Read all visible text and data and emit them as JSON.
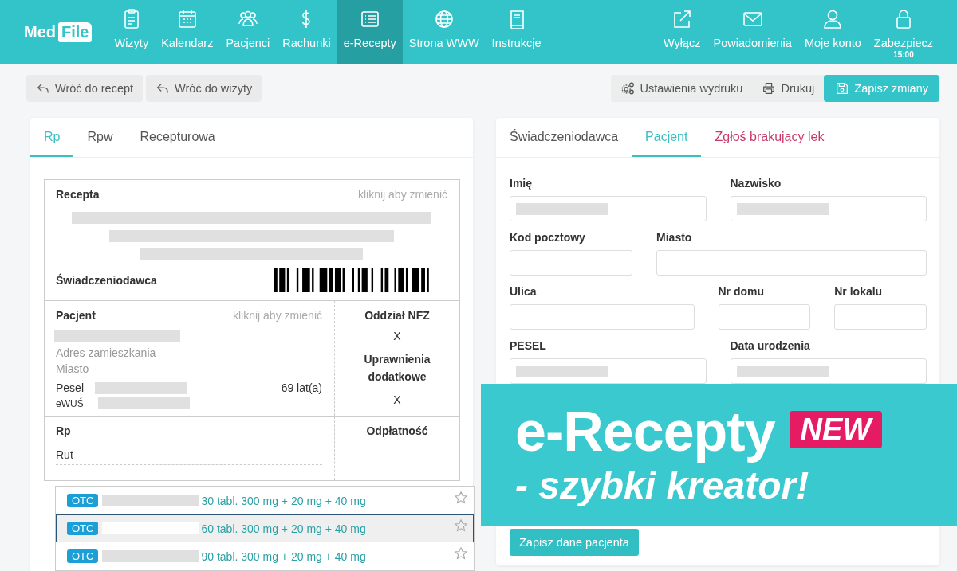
{
  "header": {
    "logo": {
      "part_1": "Med",
      "part_2": "File"
    },
    "nav": [
      {
        "label": "Wizyty",
        "selected": false
      },
      {
        "label": "Kalendarz",
        "selected": false
      },
      {
        "label": "Pacjenci",
        "selected": false
      },
      {
        "label": "Rachunki",
        "selected": false
      },
      {
        "label": "e-Recepty",
        "selected": true
      },
      {
        "label": "Strona WWW",
        "selected": false
      },
      {
        "label": "Instrukcje",
        "selected": false
      }
    ],
    "right_nav": [
      {
        "label": "Wyłącz"
      },
      {
        "label": "Powiadomienia"
      },
      {
        "label": "Moje konto"
      },
      {
        "label": "Zabezpiecz",
        "time": "15:00"
      }
    ]
  },
  "toolbar": {
    "left_buttons": [
      "Wróć do recept",
      "Wróć do wizyty"
    ],
    "right_buttons": [
      {
        "label": "Ustawienia wydruku",
        "kind": "plain"
      },
      {
        "label": "Drukuj",
        "kind": "plain"
      },
      {
        "label": "Zapisz zmiany",
        "kind": "primary"
      }
    ]
  },
  "left_panel": {
    "tabs": [
      {
        "label": "Rp",
        "selected": true
      },
      {
        "label": "Rpw",
        "selected": false
      },
      {
        "label": "Recepturowa",
        "selected": false
      }
    ],
    "recepta": {
      "title": "Recepta",
      "hint": "kliknij aby zmienić",
      "provider_label": "Świadczeniodawca"
    },
    "patient": {
      "title": "Pacjent",
      "hint": "kliknij aby zmienić",
      "address": "Adres zamieszkania",
      "city": "Miasto",
      "pesel_label": "Pesel",
      "age": "69 lat(a)",
      "ewus_label": "eWUŚ"
    },
    "nfz": {
      "title": "Oddział NFZ",
      "value": "X"
    },
    "rights": {
      "title": "Uprawnienia dodatkowe",
      "value": "X"
    },
    "rp": {
      "title": "Rp",
      "input": "Rut",
      "payment_title": "Odpłatność"
    },
    "suggestions": [
      {
        "badge": "OTC",
        "text": "30 tabl. 300 mg + 20 mg + 40 mg",
        "selected": false
      },
      {
        "badge": "OTC",
        "text": "60 tabl. 300 mg + 20 mg + 40 mg",
        "selected": true
      },
      {
        "badge": "OTC",
        "text": "90 tabl. 300 mg + 20 mg + 40 mg",
        "selected": false
      }
    ]
  },
  "right_panel": {
    "tabs": [
      {
        "label": "Świadczeniodawca",
        "selected": false,
        "kind": "normal"
      },
      {
        "label": "Pacjent",
        "selected": true,
        "kind": "normal"
      },
      {
        "label": "Zgłoś brakujący lek",
        "selected": false,
        "kind": "alert"
      }
    ],
    "rows": [
      [
        {
          "label": "Imię",
          "redacted": true
        },
        {
          "label": "Nazwisko",
          "redacted": true
        }
      ],
      [
        {
          "label": "Kod pocztowy",
          "redacted": false
        },
        {
          "label": "Miasto",
          "redacted": false
        }
      ],
      [
        {
          "label": "Ulica",
          "redacted": false
        },
        {
          "label": "Nr domu",
          "redacted": false
        },
        {
          "label": "Nr lokalu",
          "redacted": false
        }
      ],
      [
        {
          "label": "PESEL",
          "redacted": true
        },
        {
          "label": "Data urodzenia",
          "redacted": true
        }
      ]
    ],
    "save_button": "Zapisz dane pacjenta"
  },
  "banner": {
    "title": "e-Recepty",
    "badge": "NEW",
    "subtitle": "- szybki kreator!"
  }
}
